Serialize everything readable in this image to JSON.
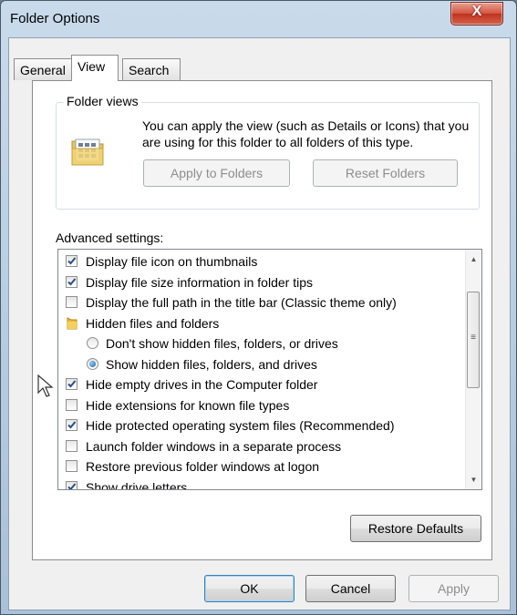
{
  "window": {
    "title": "Folder Options",
    "close_label": "X"
  },
  "tabs": [
    {
      "label": "General",
      "active": false
    },
    {
      "label": "View",
      "active": true
    },
    {
      "label": "Search",
      "active": false
    }
  ],
  "folder_views": {
    "label": "Folder views",
    "description": "You can apply the view (such as Details or Icons) that you are using for this folder to all folders of this type.",
    "apply_button": "Apply to Folders",
    "reset_button": "Reset Folders"
  },
  "advanced": {
    "label": "Advanced settings:",
    "items": [
      {
        "type": "checkbox",
        "checked": true,
        "label": "Display file icon on thumbnails"
      },
      {
        "type": "checkbox",
        "checked": true,
        "label": "Display file size information in folder tips"
      },
      {
        "type": "checkbox",
        "checked": false,
        "label": "Display the full path in the title bar (Classic theme only)"
      },
      {
        "type": "folder",
        "label": "Hidden files and folders"
      },
      {
        "type": "radio",
        "checked": false,
        "label": "Don't show hidden files, folders, or drives"
      },
      {
        "type": "radio",
        "checked": true,
        "label": "Show hidden files, folders, and drives"
      },
      {
        "type": "checkbox",
        "checked": true,
        "label": "Hide empty drives in the Computer folder"
      },
      {
        "type": "checkbox",
        "checked": false,
        "label": "Hide extensions for known file types"
      },
      {
        "type": "checkbox",
        "checked": true,
        "label": "Hide protected operating system files (Recommended)"
      },
      {
        "type": "checkbox",
        "checked": false,
        "label": "Launch folder windows in a separate process"
      },
      {
        "type": "checkbox",
        "checked": false,
        "label": "Restore previous folder windows at logon"
      },
      {
        "type": "checkbox",
        "checked": true,
        "label": "Show drive letters"
      }
    ],
    "restore_defaults": "Restore Defaults"
  },
  "footer": {
    "ok": "OK",
    "cancel": "Cancel",
    "apply": "Apply"
  }
}
